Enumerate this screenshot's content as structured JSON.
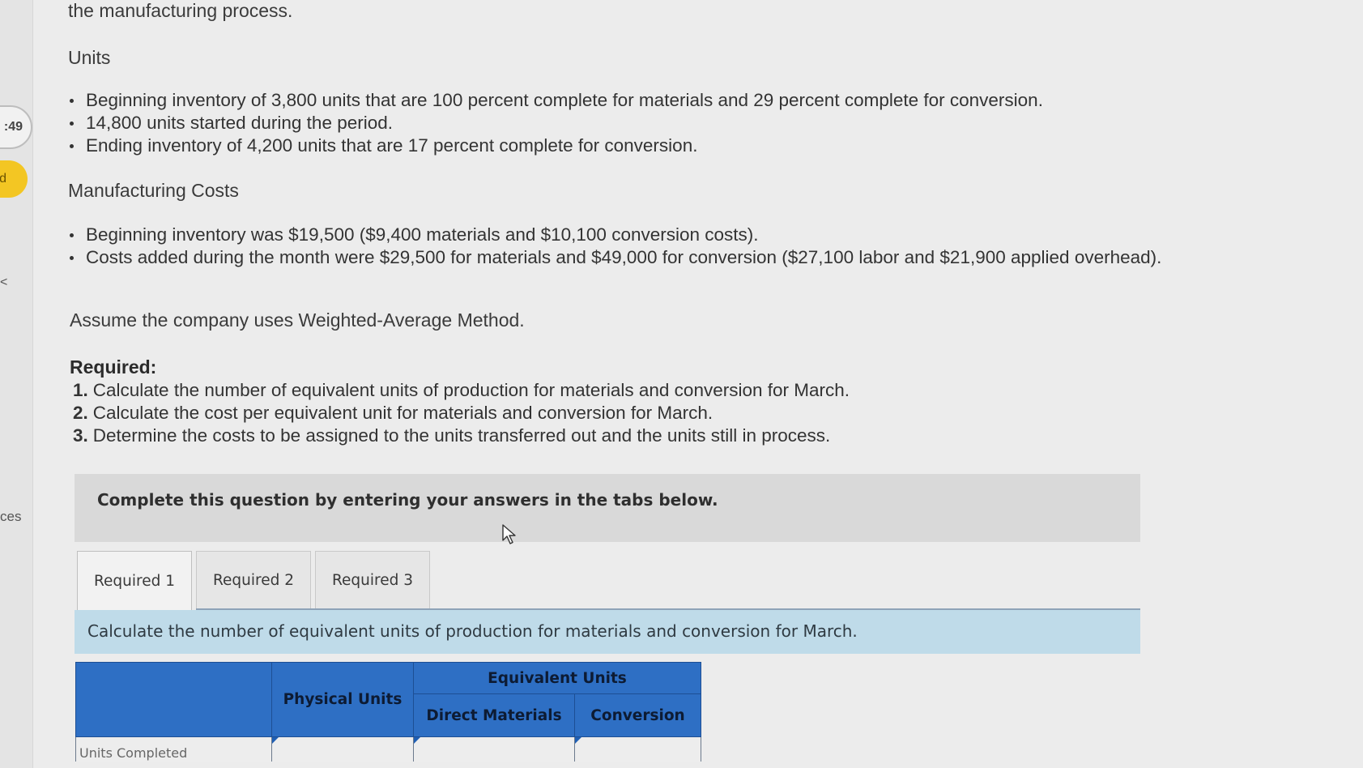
{
  "sidebar": {
    "timer": ":49",
    "badge": "d",
    "edge_label": "ces",
    "edge_mark": "<"
  },
  "problem": {
    "intro_line": "the manufacturing process.",
    "units_heading": "Units",
    "units_items": [
      "Beginning inventory of 3,800 units that are 100 percent complete for materials and 29 percent complete for conversion.",
      "14,800 units started during the period.",
      "Ending inventory of 4,200 units that are 17 percent complete for conversion."
    ],
    "costs_heading": "Manufacturing Costs",
    "costs_items": [
      "Beginning inventory was $19,500 ($9,400 materials and $10,100 conversion costs).",
      "Costs added during the month were $29,500 for materials and $49,000 for conversion ($27,100 labor and $21,900 applied overhead)."
    ],
    "assume": "Assume the company uses Weighted-Average Method.",
    "required_heading": "Required:",
    "required_items": [
      {
        "num": "1.",
        "text": "Calculate the number of equivalent units of production for materials and conversion for March."
      },
      {
        "num": "2.",
        "text": "Calculate the cost per equivalent unit for materials and conversion for March."
      },
      {
        "num": "3.",
        "text": "Determine the costs to be assigned to the units transferred out and the units still in process."
      }
    ]
  },
  "banner": {
    "text": "Complete this question by entering your answers in the tabs below."
  },
  "tabs": [
    {
      "label": "Required 1",
      "active": true
    },
    {
      "label": "Required 2",
      "active": false
    },
    {
      "label": "Required 3",
      "active": false
    }
  ],
  "task": {
    "instruction": "Calculate the number of equivalent units of production for materials and conversion for March."
  },
  "table": {
    "headers": {
      "physical_units": "Physical Units",
      "equivalent_units": "Equivalent Units",
      "direct_materials": "Direct Materials",
      "conversion": "Conversion"
    },
    "rows": [
      {
        "label": "Units Completed",
        "physical": "",
        "direct_materials": "",
        "conversion": ""
      }
    ]
  },
  "colors": {
    "table_header": "#2e6fc4",
    "task_strip": "#bfdbe9",
    "banner": "#d9d9d9",
    "badge": "#f3c623"
  }
}
